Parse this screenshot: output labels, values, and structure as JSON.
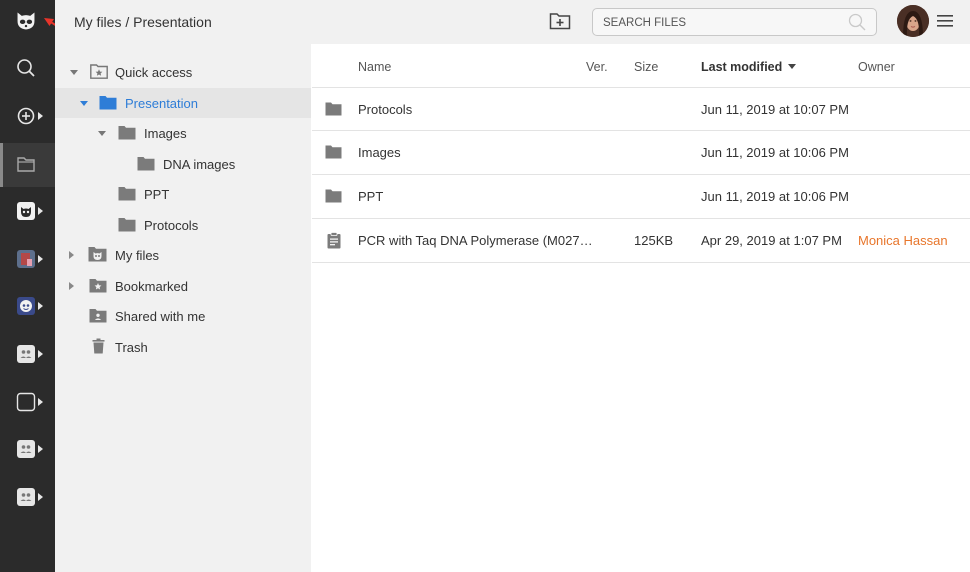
{
  "header": {
    "breadcrumb": "My files / Presentation",
    "new_folder_icon": "folder-plus-icon",
    "search_placeholder": "SEARCH FILES",
    "menu_icon": "hamburger-icon"
  },
  "rail": {
    "items": [
      {
        "icon": "raccoon-logo-icon"
      },
      {
        "icon": "search-icon"
      },
      {
        "icon": "add-circle-icon"
      },
      {
        "icon": "folder-icon"
      },
      {
        "icon": "team-avatar-icon"
      },
      {
        "icon": "team-avatar-icon"
      },
      {
        "icon": "team-avatar-icon"
      },
      {
        "icon": "team-avatar-icon"
      },
      {
        "icon": "team-avatar-icon"
      },
      {
        "icon": "team-avatar-icon"
      },
      {
        "icon": "team-avatar-icon"
      }
    ]
  },
  "tree": {
    "items": [
      {
        "label": "Quick access",
        "icon": "star-folder-icon"
      },
      {
        "label": "Presentation",
        "icon": "folder-icon"
      },
      {
        "label": "Images",
        "icon": "folder-icon"
      },
      {
        "label": "DNA images",
        "icon": "folder-icon"
      },
      {
        "label": "PPT",
        "icon": "folder-icon"
      },
      {
        "label": "Protocols",
        "icon": "folder-icon"
      },
      {
        "label": "My files",
        "icon": "raccoon-folder-icon"
      },
      {
        "label": "Bookmarked",
        "icon": "star-folder-icon"
      },
      {
        "label": "Shared with me",
        "icon": "shared-folder-icon"
      },
      {
        "label": "Trash",
        "icon": "trash-icon"
      }
    ]
  },
  "table": {
    "columns": [
      "Name",
      "Ver.",
      "Size",
      "Last modified",
      "Owner"
    ],
    "sorted_column": "Last modified",
    "rows": [
      {
        "icon": "folder-icon",
        "name": "Protocols",
        "ver": "",
        "size": "",
        "modified": "Jun 11, 2019 at 10:07 PM",
        "owner": ""
      },
      {
        "icon": "folder-icon",
        "name": "Images",
        "ver": "",
        "size": "",
        "modified": "Jun 11, 2019 at 10:06 PM",
        "owner": ""
      },
      {
        "icon": "folder-icon",
        "name": "PPT",
        "ver": "",
        "size": "",
        "modified": "Jun 11, 2019 at 10:06 PM",
        "owner": ""
      },
      {
        "icon": "document-icon",
        "name": "PCR with Taq DNA Polymerase (M027…",
        "ver": "",
        "size": "125KB",
        "modified": "Apr 29, 2019 at 1:07 PM",
        "owner": "Monica Hassan"
      }
    ]
  },
  "colors": {
    "rail_bg": "#2b2b2b",
    "panel_bg": "#f1f1f1",
    "selected_text": "#2e7dd7",
    "owner_text": "#e8762b",
    "annotation_arrow": "#e8342a"
  }
}
